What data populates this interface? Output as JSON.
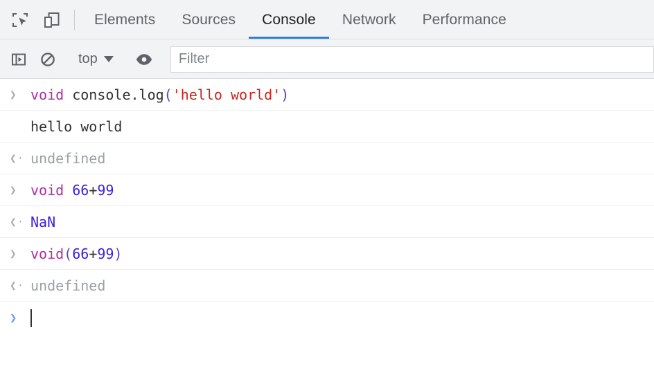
{
  "window": {
    "app": "Chrome DevTools",
    "accent_color": "#2f7de1",
    "toolbar_bg": "#f1f3f4",
    "body_bg": "#ffffff"
  },
  "tabbar": {
    "inspect_icon": "inspect-element-icon",
    "device_icon": "device-toolbar-icon",
    "tabs": [
      {
        "label": "Elements",
        "active": false
      },
      {
        "label": "Sources",
        "active": false
      },
      {
        "label": "Console",
        "active": true
      },
      {
        "label": "Network",
        "active": false
      },
      {
        "label": "Performance",
        "active": false
      }
    ]
  },
  "consolebar": {
    "sidebar_toggle_icon": "console-sidebar-toggle-icon",
    "clear_icon": "clear-console-icon",
    "context": {
      "value": "top",
      "caret_icon": "chevron-down-icon"
    },
    "live_expression_icon": "eye-icon",
    "filter": {
      "placeholder": "Filter",
      "value": ""
    }
  },
  "console": {
    "entries": [
      {
        "kind": "input",
        "gutter": "in",
        "tokens": [
          {
            "text": "void ",
            "type": "keyword"
          },
          {
            "text": "console.log",
            "type": "plain"
          },
          {
            "text": "(",
            "type": "punct"
          },
          {
            "text": "'hello world'",
            "type": "string"
          },
          {
            "text": ")",
            "type": "punct"
          }
        ],
        "plain": "void console.log('hello world')"
      },
      {
        "kind": "log",
        "gutter": "blank",
        "tokens": [
          {
            "text": "hello world",
            "type": "plain"
          }
        ],
        "plain": "hello world"
      },
      {
        "kind": "result",
        "gutter": "out",
        "tokens": [
          {
            "text": "undefined",
            "type": "undefined"
          }
        ],
        "plain": "undefined"
      },
      {
        "kind": "input",
        "gutter": "in",
        "tokens": [
          {
            "text": "void ",
            "type": "keyword"
          },
          {
            "text": "66",
            "type": "number"
          },
          {
            "text": "+",
            "type": "plain"
          },
          {
            "text": "99",
            "type": "number"
          }
        ],
        "plain": "void 66+99"
      },
      {
        "kind": "result",
        "gutter": "out",
        "tokens": [
          {
            "text": "NaN",
            "type": "number"
          }
        ],
        "plain": "NaN"
      },
      {
        "kind": "input",
        "gutter": "in",
        "tokens": [
          {
            "text": "void",
            "type": "keyword"
          },
          {
            "text": "(",
            "type": "punct"
          },
          {
            "text": "66",
            "type": "number"
          },
          {
            "text": "+",
            "type": "plain"
          },
          {
            "text": "99",
            "type": "number"
          },
          {
            "text": ")",
            "type": "punct"
          }
        ],
        "plain": "void(66+99)"
      },
      {
        "kind": "result",
        "gutter": "out",
        "tokens": [
          {
            "text": "undefined",
            "type": "undefined"
          }
        ],
        "plain": "undefined"
      }
    ],
    "prompt": {
      "arrow": "❯",
      "value": ""
    }
  }
}
